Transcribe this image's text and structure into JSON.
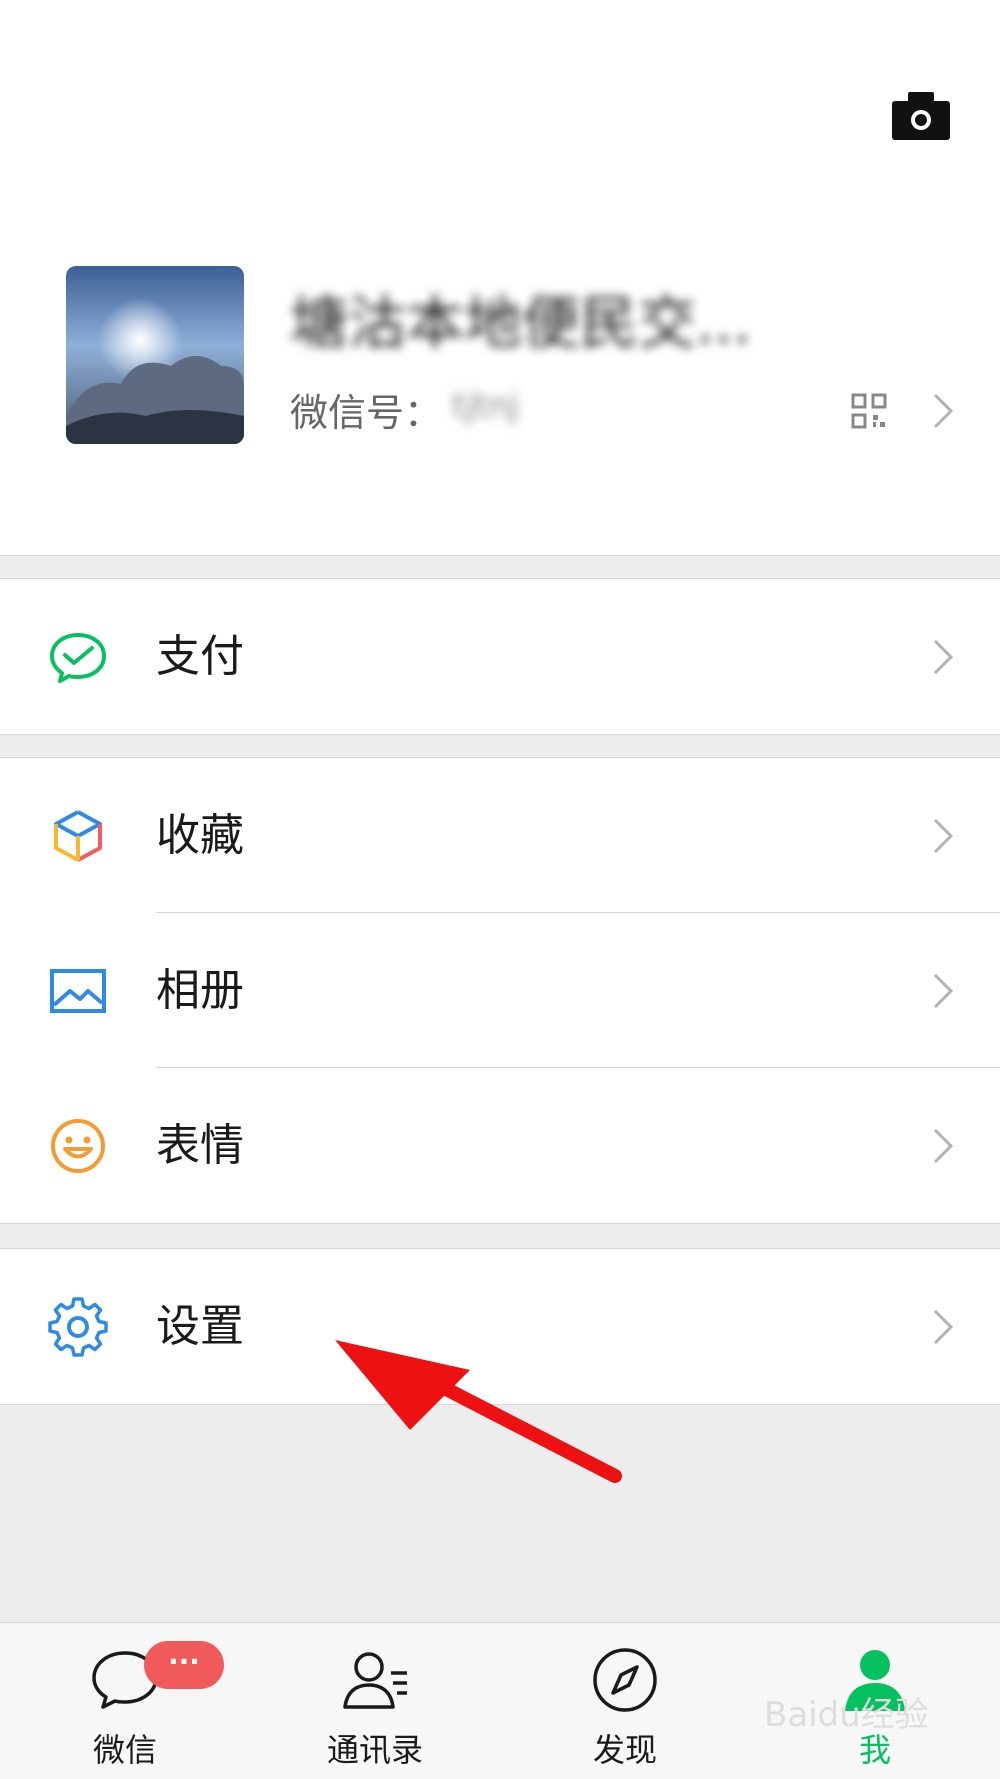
{
  "profile": {
    "nickname": "塘沽本地便民交...",
    "wxid_label": "微信号：",
    "wxid_value": "tjtnj"
  },
  "menu": {
    "pay": {
      "label": "支付",
      "icon": "wechat-pay-icon"
    },
    "favorites": {
      "label": "收藏",
      "icon": "cube-icon"
    },
    "album": {
      "label": "相册",
      "icon": "picture-icon"
    },
    "stickers": {
      "label": "表情",
      "icon": "smiley-icon"
    },
    "settings": {
      "label": "设置",
      "icon": "gear-icon"
    }
  },
  "tabbar": {
    "chats": {
      "label": "微信",
      "badge": "···"
    },
    "contacts": {
      "label": "通讯录"
    },
    "discover": {
      "label": "发现"
    },
    "me": {
      "label": "我"
    }
  },
  "colors": {
    "accent": "#07c160",
    "badge": "#f05a5a",
    "arrow": "#ee1111"
  },
  "watermark": "Baidu经验"
}
